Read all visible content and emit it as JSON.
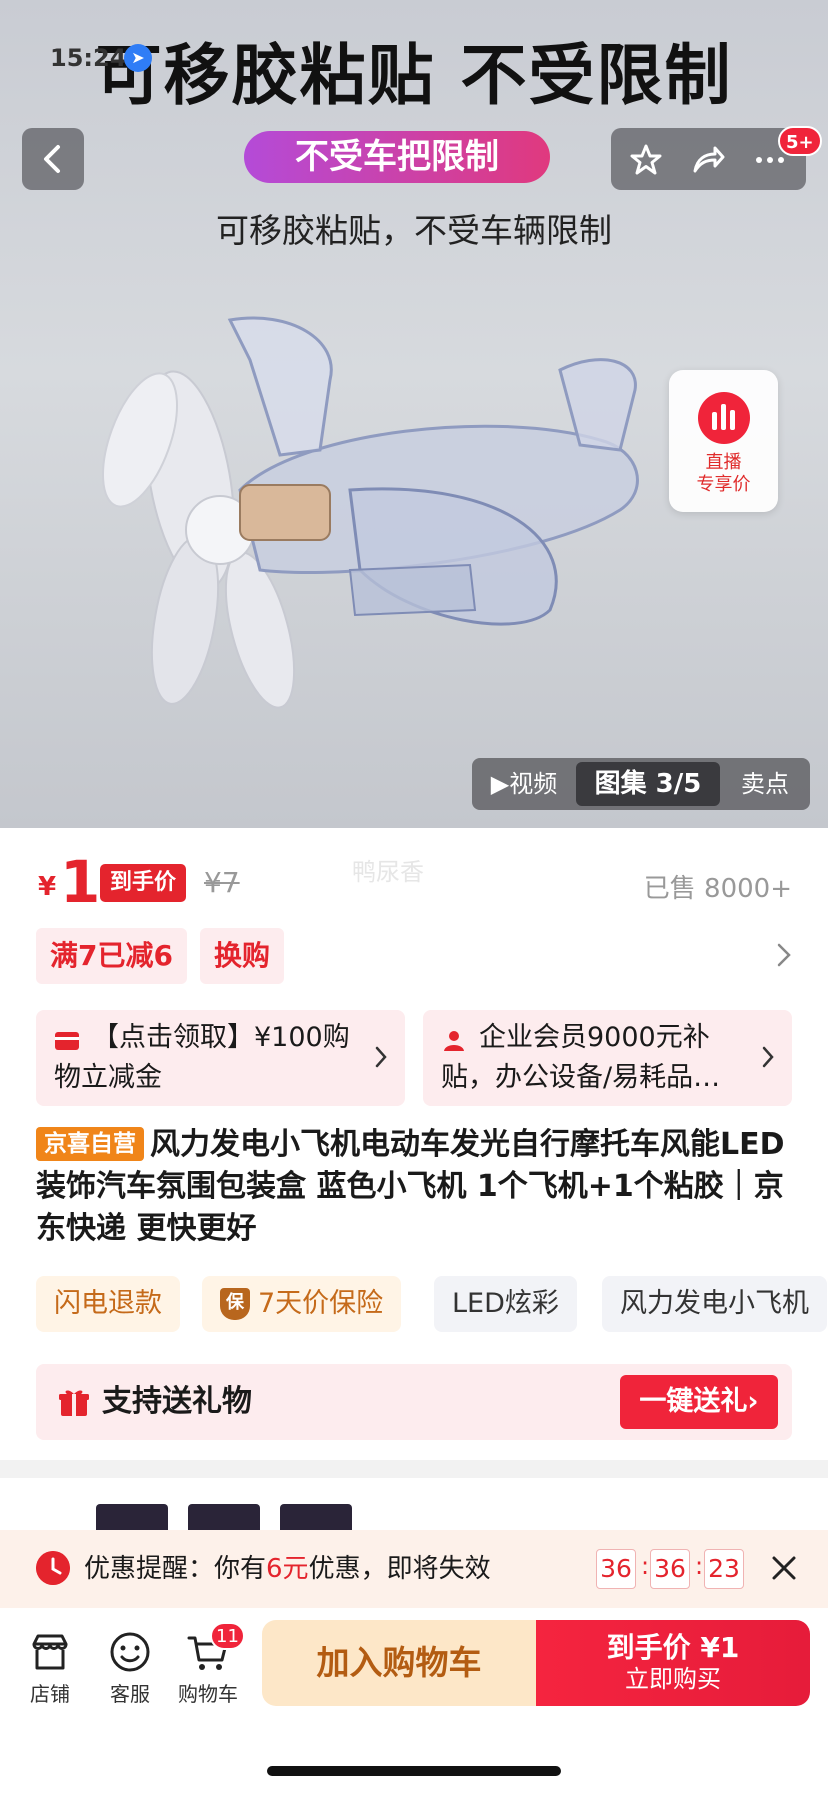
{
  "status": {
    "time": "15:24"
  },
  "hero": {
    "headline": "可移胶粘贴  不受限制",
    "pill": "不受车把限制",
    "subtitle": "可移胶粘贴，不受车辆限制",
    "cart_count_badge": "5+",
    "live": {
      "line1": "直播",
      "line2": "专享价"
    },
    "media_tabs": [
      "▶视频",
      "图集 3/5",
      "卖点"
    ]
  },
  "product": {
    "watermark": "鸭尿香",
    "price_symbol": "¥",
    "price": "1",
    "price_tag": "到手价",
    "original_price": "¥7",
    "sold": "已售 8000+",
    "promos": [
      "满7已减6",
      "换购"
    ],
    "coupons": [
      {
        "text": "【点击领取】¥100购物立减金"
      },
      {
        "text": "企业会员9000元补贴，办公设备/易耗品…"
      }
    ],
    "badge": "京喜自营",
    "title": "风力发电小飞机电动车发光自行摩托车风能LED装饰汽车氛围包装盒 蓝色小飞机 1个飞机+1个粘胶",
    "title_suffix": "｜京东快递 更快更好",
    "tags": [
      "闪电退款",
      "7天价保险",
      "LED炫彩",
      "风力发电小飞机"
    ],
    "shield_glyph": "保",
    "gift": {
      "label": "支持送礼物",
      "button": "一键送礼›"
    }
  },
  "reminder": {
    "prefix": "优惠提醒：你有",
    "amount": "6元",
    "suffix": "优惠，即将失效",
    "countdown": [
      "36",
      "36",
      "23"
    ]
  },
  "bottom": {
    "items": [
      "店铺",
      "客服",
      "购物车"
    ],
    "cart_badge": "11",
    "add_cart": "加入购物车",
    "buy_line1": "到手价 ¥1",
    "buy_line2": "立即购买"
  },
  "colors": {
    "accent": "#e4242d",
    "brand_orange": "#f08519",
    "cart_btn_bg": "#fde7c8"
  }
}
